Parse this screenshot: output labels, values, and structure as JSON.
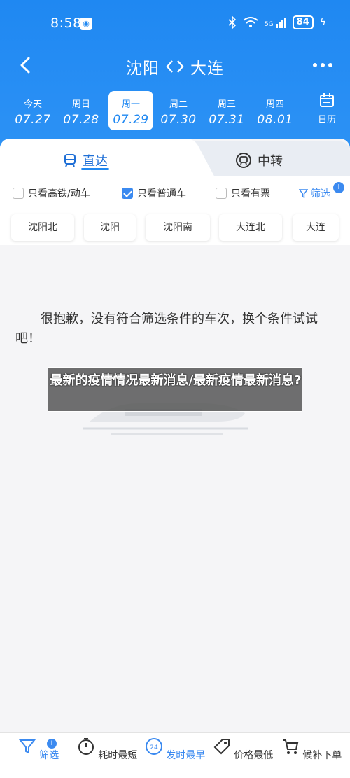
{
  "status_bar": {
    "time": "8:58",
    "battery": "84",
    "network": "5G"
  },
  "nav": {
    "from": "沈阳",
    "to": "大连"
  },
  "dates": [
    {
      "dow": "今天",
      "date": "07.27"
    },
    {
      "dow": "周日",
      "date": "07.28"
    },
    {
      "dow": "周一",
      "date": "07.29"
    },
    {
      "dow": "周二",
      "date": "07.30"
    },
    {
      "dow": "周三",
      "date": "07.31"
    },
    {
      "dow": "周四",
      "date": "08.01"
    }
  ],
  "selected_date_index": 2,
  "calendar_label": "日历",
  "tabs": {
    "direct": "直达",
    "transfer": "中转"
  },
  "filters": {
    "highspeed": "只看高铁/动车",
    "regular": "只看普通车",
    "available": "只看有票",
    "screen": "筛选",
    "screen_badge": "I"
  },
  "filter_state": {
    "highspeed": false,
    "regular": true,
    "available": false
  },
  "stations": [
    "沈阳北",
    "沈阳",
    "沈阳南",
    "大连北",
    "大连"
  ],
  "empty_message": "很抱歉，没有符合筛选条件的车次，换个条件试试吧！",
  "overlay_text": "最新的疫情情况最新消息/最新疫情最新消息?",
  "bottom_bar": {
    "screen": "筛选",
    "screen_badge": "I",
    "duration": "耗时最短",
    "depart": "发时最早",
    "price": "价格最低",
    "waitlist": "候补下单"
  },
  "colors": {
    "brand": "#1f88f2",
    "accent": "#3b8af0"
  }
}
